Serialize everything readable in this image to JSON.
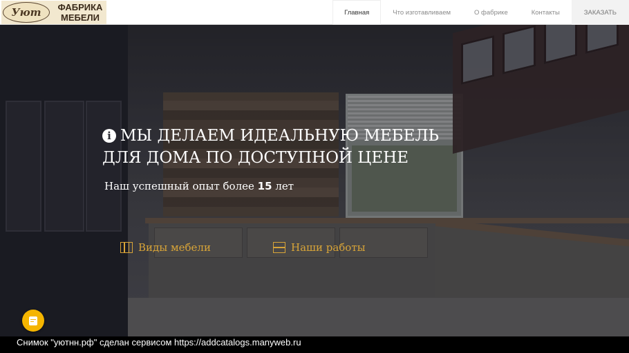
{
  "header": {
    "logo_script": "Уют",
    "logo_line1": "ФАБРИКА",
    "logo_line2": "МЕБЕЛИ",
    "nav": [
      {
        "label": "Главная",
        "active": true
      },
      {
        "label": "Что изготавливаем",
        "active": false
      },
      {
        "label": "О фабрике",
        "active": false
      },
      {
        "label": "Контакты",
        "active": false
      }
    ],
    "cta_label": "ЗАКАЗАТЬ"
  },
  "hero": {
    "headline_line1": "МЫ ДЕЛАЕМ ИДЕАЛЬНУЮ МЕБЕЛЬ",
    "headline_line2": "ДЛЯ ДОМА ПО ДОСТУПНОЙ ЦЕНЕ",
    "subline_text": "Наш успешный опыт более",
    "subline_number": "15",
    "subline_suffix": "лет",
    "buttons": {
      "types_label": "Виды мебели",
      "works_label": "Наши работы"
    },
    "info_icon": "info-circle-icon"
  },
  "fab": {
    "icon": "document-icon"
  },
  "footer_caption": "Снимок \"уютнн.рф\" сделан сервисом https://addcatalogs.manyweb.ru",
  "colors": {
    "accent_gold": "#d8a438",
    "fab_yellow": "#f5b500",
    "logo_bg": "#f2e8cf"
  }
}
